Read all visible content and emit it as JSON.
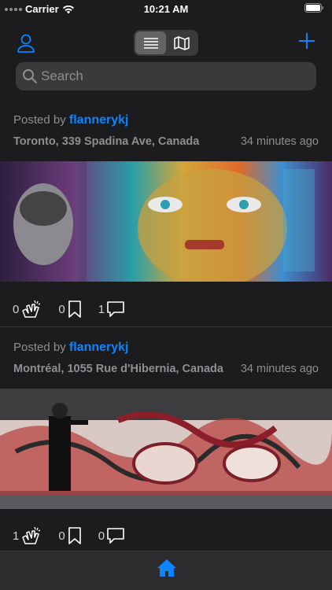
{
  "status_bar": {
    "carrier": "Carrier",
    "time": "10:21 AM"
  },
  "nav": {
    "profile_icon": "person-icon",
    "list_icon": "list-icon",
    "map_icon": "map-icon",
    "add_icon": "plus-icon",
    "accent": "#0a84ff"
  },
  "search": {
    "placeholder": "Search"
  },
  "posts": [
    {
      "posted_by_label": "Posted by",
      "user": "flannerykj",
      "location": "Toronto, 339 Spadina Ave, Canada",
      "time": "34 minutes ago",
      "claps": "0",
      "bookmarks": "0",
      "comments": "1"
    },
    {
      "posted_by_label": "Posted by",
      "user": "flannerykj",
      "location": "Montréal, 1055 Rue d'Hibernia, Canada",
      "time": "34 minutes ago",
      "claps": "1",
      "bookmarks": "0",
      "comments": "0"
    }
  ],
  "tabbar": {
    "home_icon": "home-icon"
  }
}
